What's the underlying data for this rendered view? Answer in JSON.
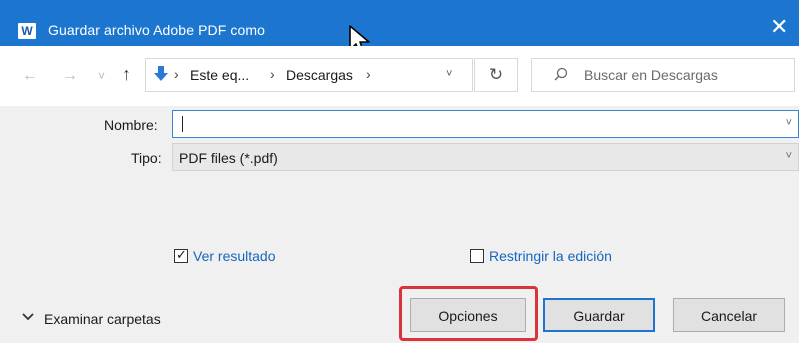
{
  "window": {
    "title": "Guardar archivo Adobe PDF como",
    "app_icon_letter": "W",
    "close_glyph": "✕"
  },
  "navigation": {
    "back_glyph": "←",
    "forward_glyph": "→",
    "recent_glyph": "˅",
    "up_glyph": "↑",
    "breadcrumb": [
      "Este eq...",
      "Descargas"
    ],
    "dropdown_glyph": "˅",
    "refresh_glyph": "↻",
    "search_placeholder": "Buscar en Descargas"
  },
  "form": {
    "name_label": "Nombre:",
    "name_value": "",
    "type_label": "Tipo:",
    "type_value": "PDF files (*.pdf)"
  },
  "options": {
    "view_result_label": "Ver resultado",
    "view_result_checked": true,
    "restrict_edit_label": "Restringir la edición",
    "restrict_edit_checked": false
  },
  "footer": {
    "browse_folders_label": "Examinar carpetas",
    "options_button": "Opciones",
    "save_button": "Guardar",
    "cancel_button": "Cancelar"
  },
  "colors": {
    "titlebar": "#1c76d0",
    "link": "#1565c0",
    "highlight": "#d9343b"
  }
}
